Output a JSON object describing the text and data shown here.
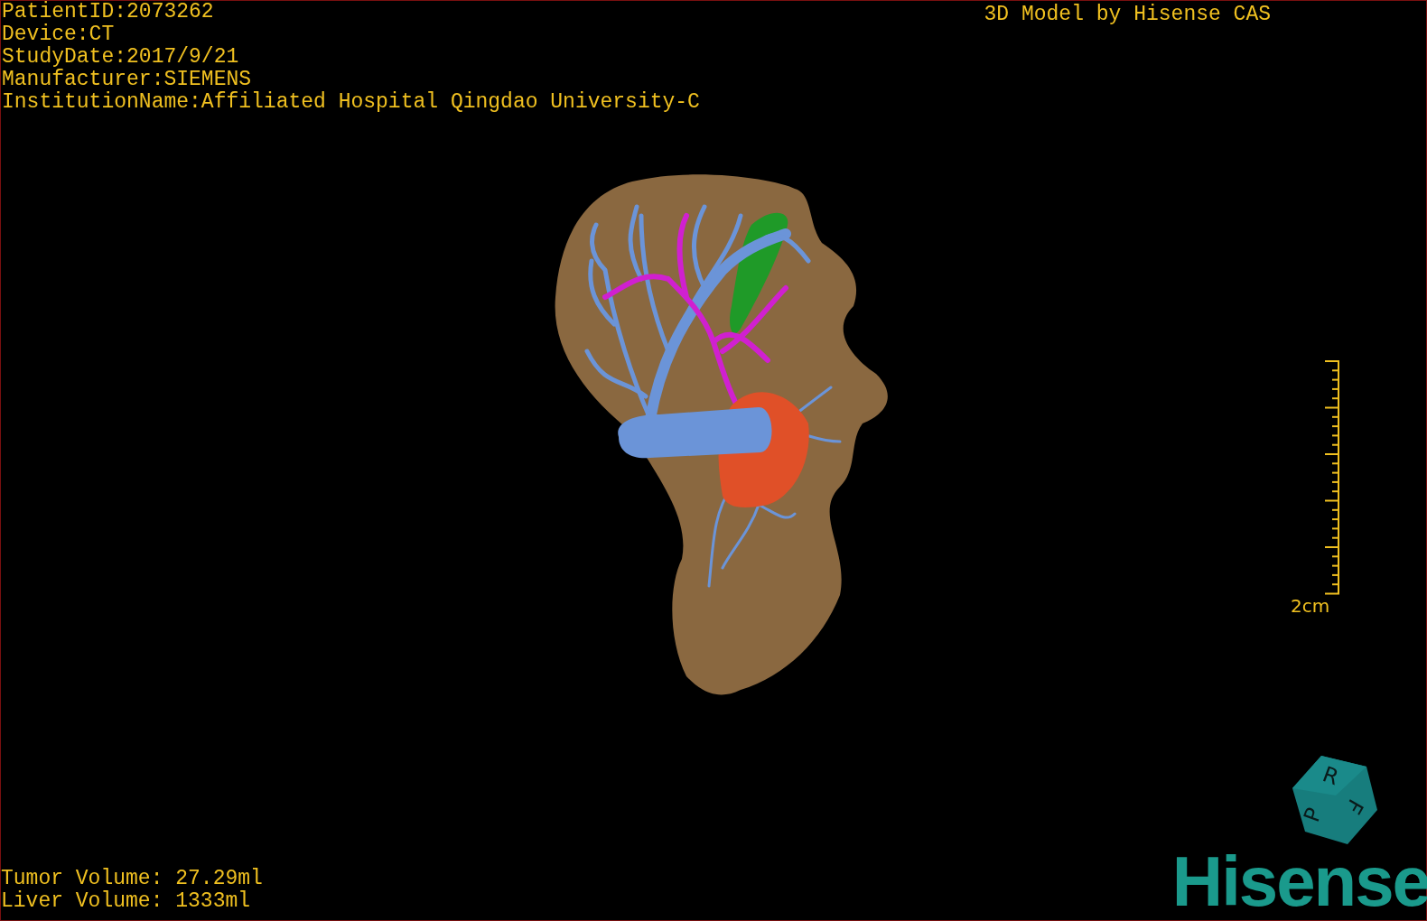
{
  "study_info": [
    "PatientID:2073262",
    "Device:CT",
    "StudyDate:2017/9/21",
    "Manufacturer:SIEMENS",
    "InstitutionName:Affiliated Hospital Qingdao University-C"
  ],
  "title": "3D Model by Hisense CAS",
  "scale": {
    "label": "2cm"
  },
  "volumes": [
    "Tumor Volume: 27.29ml",
    "Liver Volume: 1333ml"
  ],
  "orientation_cube": {
    "faces": [
      "R",
      "F",
      "P"
    ]
  },
  "logo": "Hisense"
}
